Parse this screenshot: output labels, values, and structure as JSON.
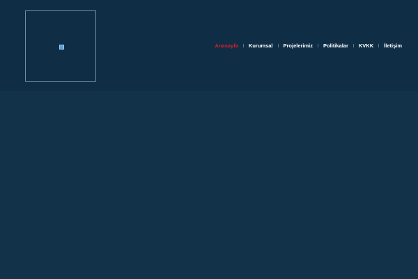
{
  "header": {
    "logo": {
      "icon": "broken-image-icon"
    }
  },
  "nav": {
    "items": [
      {
        "label": "Anasayfa",
        "active": true
      },
      {
        "label": "Kurumsal",
        "active": false
      },
      {
        "label": "Projelerimiz",
        "active": false
      },
      {
        "label": "Politikalar",
        "active": false
      },
      {
        "label": "KVKK",
        "active": false
      },
      {
        "label": "İletişim",
        "active": false
      }
    ]
  },
  "colors": {
    "header_bg": "#0f2e46",
    "page_bg": "#12324a",
    "nav_text": "#ffffff",
    "nav_active": "#d71f26"
  }
}
